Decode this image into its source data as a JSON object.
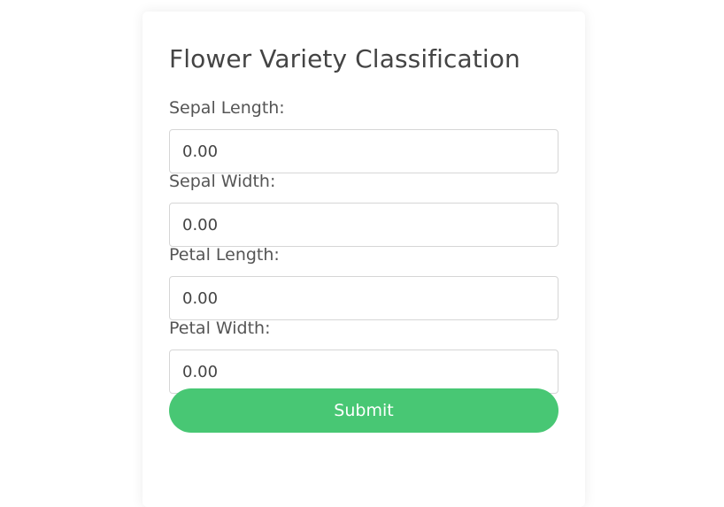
{
  "form": {
    "title": "Flower Variety Classification",
    "fields": [
      {
        "label": "Sepal Length:",
        "value": "0.00"
      },
      {
        "label": "Sepal Width:",
        "value": "0.00"
      },
      {
        "label": "Petal Length:",
        "value": "0.00"
      },
      {
        "label": "Petal Width:",
        "value": "0.00"
      }
    ],
    "submit_label": "Submit"
  },
  "colors": {
    "submit_background": "#48c774",
    "text": "#444444"
  }
}
